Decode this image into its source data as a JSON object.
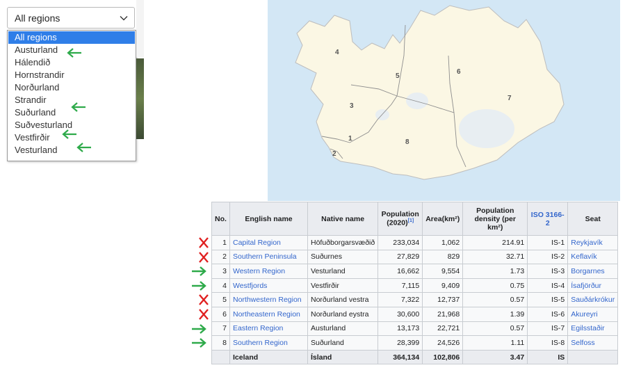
{
  "dropdown": {
    "selected_value": "All regions",
    "options": [
      "All regions",
      "Austurland",
      "Hálendið",
      "Hornstrandir",
      "Norðurland",
      "Strandir",
      "Suðurland",
      "Suðvesturland",
      "Vestfirðir",
      "Vesturland"
    ]
  },
  "map": {
    "labels": [
      "4",
      "5",
      "6",
      "3",
      "7",
      "8",
      "1",
      "2"
    ]
  },
  "table": {
    "headers": {
      "no": "No.",
      "english": "English name",
      "native": "Native name",
      "population": "Population (2020)",
      "population_ref": "[1]",
      "area": "Area(km²)",
      "density": "Population density (per km²)",
      "iso": "ISO 3166-2",
      "seat": "Seat"
    },
    "rows": [
      {
        "no": "1",
        "english": "Capital Region",
        "native": "Höfuðborgarsvæðið",
        "population": "233,034",
        "area": "1,062",
        "density": "214.91",
        "iso": "IS-1",
        "seat": "Reykjavík"
      },
      {
        "no": "2",
        "english": "Southern Peninsula",
        "native": "Suðurnes",
        "population": "27,829",
        "area": "829",
        "density": "32.71",
        "iso": "IS-2",
        "seat": "Keflavík"
      },
      {
        "no": "3",
        "english": "Western Region",
        "native": "Vesturland",
        "population": "16,662",
        "area": "9,554",
        "density": "1.73",
        "iso": "IS-3",
        "seat": "Borgarnes"
      },
      {
        "no": "4",
        "english": "Westfjords",
        "native": "Vestfirðir",
        "population": "7,115",
        "area": "9,409",
        "density": "0.75",
        "iso": "IS-4",
        "seat": "Ísafjörður"
      },
      {
        "no": "5",
        "english": "Northwestern Region",
        "native": "Norðurland vestra",
        "population": "7,322",
        "area": "12,737",
        "density": "0.57",
        "iso": "IS-5",
        "seat": "Sauðárkrókur"
      },
      {
        "no": "6",
        "english": "Northeastern Region",
        "native": "Norðurland eystra",
        "population": "30,600",
        "area": "21,968",
        "density": "1.39",
        "iso": "IS-6",
        "seat": "Akureyri"
      },
      {
        "no": "7",
        "english": "Eastern Region",
        "native": "Austurland",
        "population": "13,173",
        "area": "22,721",
        "density": "0.57",
        "iso": "IS-7",
        "seat": "Egilsstaðir"
      },
      {
        "no": "8",
        "english": "Southern Region",
        "native": "Suðurland",
        "population": "28,399",
        "area": "24,526",
        "density": "1.11",
        "iso": "IS-8",
        "seat": "Selfoss"
      }
    ],
    "total": {
      "english": "Iceland",
      "native": "Ísland",
      "population": "364,134",
      "area": "102,806",
      "density": "3.47",
      "iso": "IS"
    }
  },
  "annotations": {
    "arrow_color": "#2eaa4a",
    "cross_color": "#e02020",
    "dropdown_arrows": [
      "Austurland",
      "Suðurland",
      "Vestfirðir",
      "Vesturland"
    ],
    "row_marks": [
      "cross",
      "cross",
      "arrow",
      "arrow",
      "cross",
      "cross",
      "arrow",
      "arrow"
    ]
  }
}
